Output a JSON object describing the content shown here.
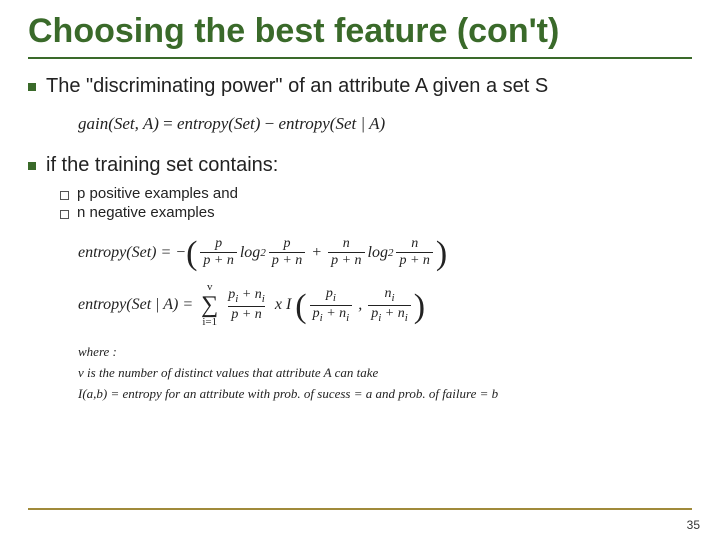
{
  "title": "Choosing the best feature (con't)",
  "bullets": {
    "b1": "The \"discriminating power\" of an attribute A given a set S",
    "b2": "if the training set contains:",
    "sub": {
      "s1": "p positive examples and",
      "s2": "n negative examples"
    }
  },
  "formulas": {
    "gain_lhs": "gain(Set, A)",
    "eq": "=",
    "ent_set": "entropy(Set)",
    "minus": "−",
    "ent_setA": "entropy(Set | A)",
    "entropy_label": "entropy(Set)",
    "entropy_cond_label": "entropy(Set | A)",
    "neg": "−",
    "p": "p",
    "n": "n",
    "pn": "p + n",
    "log2": "log",
    "two": "2",
    "plus": "+",
    "pi": "p",
    "ni": "n",
    "pi_ni": "p",
    "i": "i",
    "v": "v",
    "i1": "i=1",
    "xI": "x I",
    "comma": ",",
    "sigma": "∑"
  },
  "where": {
    "w0": "where :",
    "w1": "v is the number of distinct values that attribute A can take",
    "w2": "I(a,b) = entropy for an attribute with prob. of sucess = a and prob. of failure = b"
  },
  "page": "35"
}
